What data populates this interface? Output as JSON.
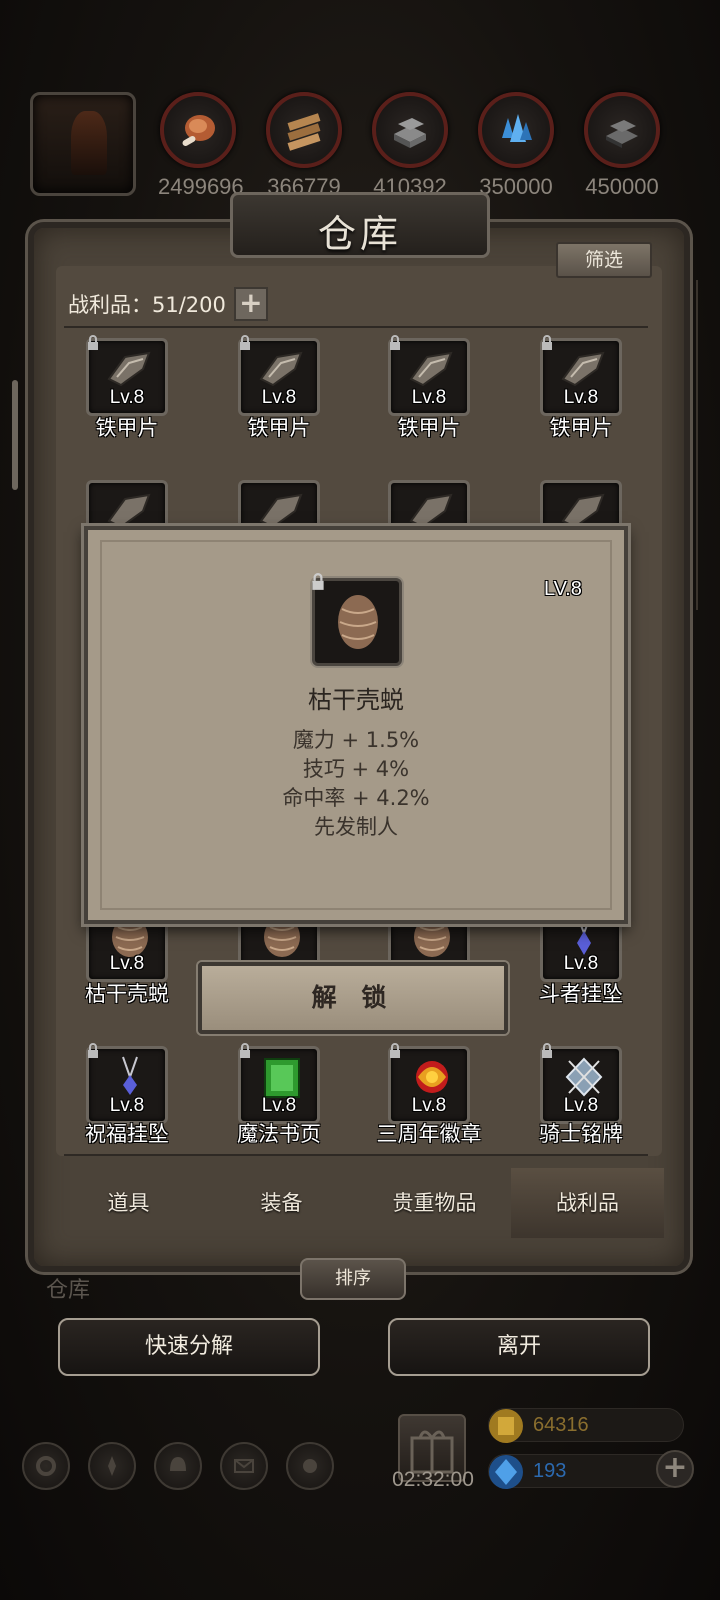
{
  "resources": [
    {
      "value": "2499696",
      "icon": "meat-icon",
      "color": "#c0683a"
    },
    {
      "value": "366779",
      "icon": "wood-planks-icon",
      "color": "#a87a4a"
    },
    {
      "value": "410392",
      "icon": "iron-ingot-icon",
      "color": "#7a7a7a"
    },
    {
      "value": "350000",
      "icon": "crystal-icon",
      "color": "#3c8fd8"
    },
    {
      "value": "450000",
      "icon": "steel-ingot-icon",
      "color": "#5a5a5a"
    }
  ],
  "panel": {
    "title": "仓库",
    "filter_label": "筛选",
    "count_label": "战利品：51/200",
    "add_label": "+"
  },
  "grid": {
    "row1": [
      {
        "level": "Lv.8",
        "name": "铁甲片",
        "icon": "iron-plate-icon"
      },
      {
        "level": "Lv.8",
        "name": "铁甲片",
        "icon": "iron-plate-icon"
      },
      {
        "level": "Lv.8",
        "name": "铁甲片",
        "icon": "iron-plate-icon"
      },
      {
        "level": "Lv.8",
        "name": "铁甲片",
        "icon": "iron-plate-icon"
      }
    ],
    "row_bottom_a": [
      {
        "level": "Lv.8",
        "name": "枯干壳蜕",
        "icon": "shell-icon"
      },
      {
        "level": "",
        "name": "",
        "icon": "shell-icon"
      },
      {
        "level": "",
        "name": "",
        "icon": "shell-icon"
      },
      {
        "level": "Lv.8",
        "name": "斗者挂坠",
        "icon": "pendant-icon"
      }
    ],
    "row_bottom_b": [
      {
        "level": "Lv.8",
        "name": "祝福挂坠",
        "icon": "pendant-icon"
      },
      {
        "level": "Lv.8",
        "name": "魔法书页",
        "icon": "spellbook-page-icon"
      },
      {
        "level": "Lv.8",
        "name": "三周年徽章",
        "icon": "anniversary-badge-icon"
      },
      {
        "level": "Lv.8",
        "name": "骑士铭牌",
        "icon": "knight-plate-icon"
      }
    ]
  },
  "tabs": [
    "道具",
    "装备",
    "贵重物品",
    "战利品"
  ],
  "sort_label": "排序",
  "ghost_label": "仓库",
  "actions": {
    "decompose_label": "快速分解",
    "leave_label": "离开"
  },
  "footer": {
    "timer": "02:32:00",
    "gold": "64316",
    "gems": "193",
    "plus": "+"
  },
  "modal": {
    "level": "LV.8",
    "item_name": "枯干壳蜕",
    "stats": [
      "魔力 + 1.5%",
      "技巧 + 4%",
      "命中率 + 4.2%",
      "先发制人"
    ],
    "unlock_label": "解 锁"
  }
}
